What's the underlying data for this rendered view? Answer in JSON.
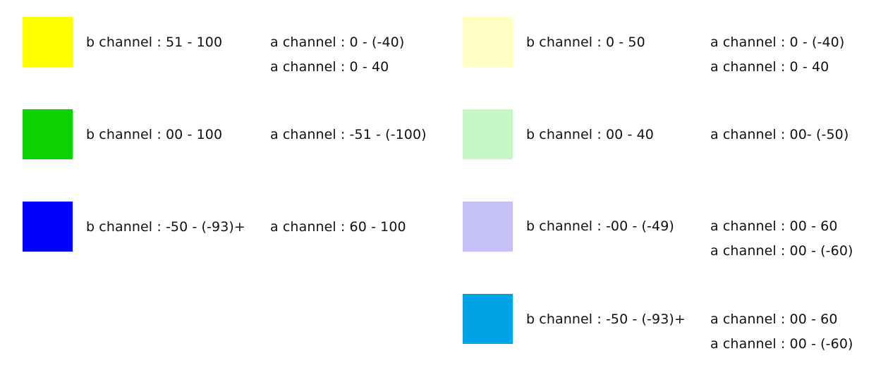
{
  "entries": [
    {
      "color": "#FFFF00",
      "b_label": "b channel : 51 - 100",
      "a_labels": [
        "a channel : 0 - (-40)",
        "a channel : 0 - 40"
      ]
    },
    {
      "color": "#0DD400",
      "b_label": "b channel : 00 - 100",
      "a_labels": [
        "a channel : -51 - (-100)"
      ]
    },
    {
      "color": "#0000FF",
      "b_label": "b channel : -50 - (-93)+",
      "a_labels": [
        "a channel : 60 - 100"
      ]
    },
    {
      "color": "#FFFFC6",
      "b_label": "b channel : 0 - 50",
      "a_labels": [
        "a channel : 0 - (-40)",
        "a channel : 0 - 40"
      ]
    },
    {
      "color": "#C6F5C6",
      "b_label": "b channel : 00 - 40",
      "a_labels": [
        "a channel : 00- (-50)"
      ]
    },
    {
      "color": "#C6C2F5",
      "b_label": "b channel : -00 - (-49)",
      "a_labels": [
        "a channel : 00 - 60",
        "a channel : 00 - (-60)"
      ]
    },
    {
      "color": "#00A2E6",
      "b_label": "b channel : -50 - (-93)+",
      "a_labels": [
        "a channel : 00 - 60",
        "a channel : 00 - (-60)"
      ]
    }
  ]
}
